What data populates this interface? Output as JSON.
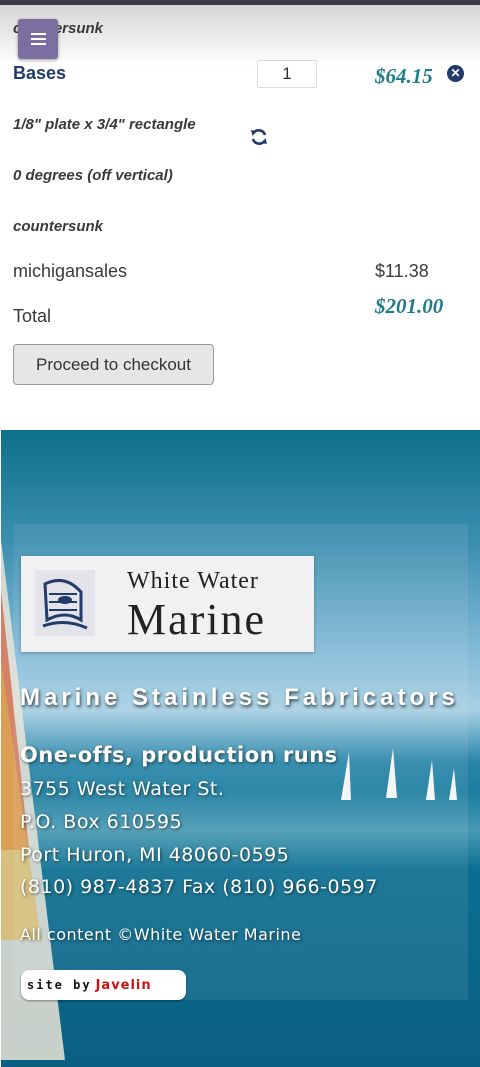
{
  "header": {
    "menu_icon": "hamburger-menu-icon"
  },
  "cart": {
    "overflow_option": "countersunk",
    "item": {
      "name": "Bases",
      "quantity": "1",
      "price": "$64.15",
      "options": [
        "1/8\" plate x 3/4\" rectangle",
        "0 degrees (off vertical)",
        "countersunk"
      ],
      "remove_icon": "remove-circle-icon",
      "refresh_icon": "refresh-icon"
    },
    "shipping": {
      "label": "michigansales",
      "value": "$11.38"
    },
    "total": {
      "label": "Total",
      "value": "$201.00"
    },
    "checkout_label": "Proceed to checkout"
  },
  "footer": {
    "logo": {
      "line1": "White Water",
      "line2": "Marine"
    },
    "heading": "Marine Stainless Fabricators",
    "tagline": "One-offs, production runs",
    "address1": "3755 West Water St.",
    "address2": "P.O. Box 610595",
    "address3": "Port Huron, MI 48060-0595",
    "phone": "(810) 987-4837 Fax (810) 966-0597",
    "copyright": "All content ©White Water Marine",
    "siteby": {
      "prefix": "site by",
      "brand": "Javelin"
    }
  },
  "colors": {
    "accent": "#1f7c8a",
    "brand": "#233b6a",
    "menu": "#7a6fa0"
  }
}
